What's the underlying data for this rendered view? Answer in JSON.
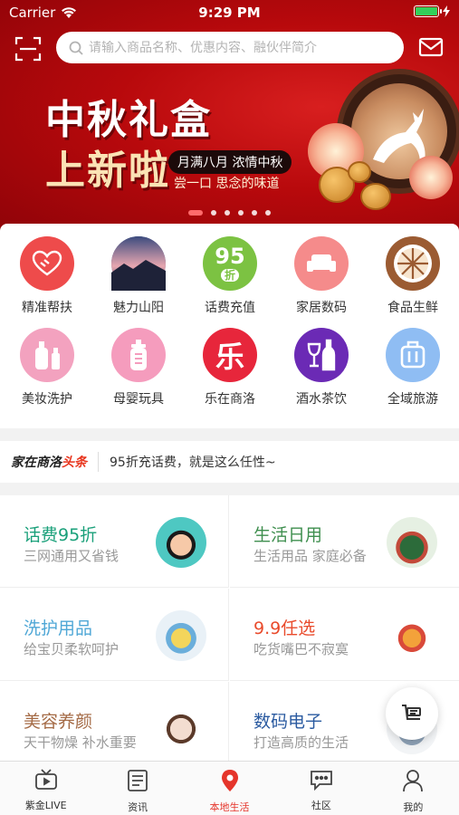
{
  "status_bar": {
    "carrier": "Carrier",
    "time": "9:29 PM",
    "battery_level": 1.0
  },
  "search": {
    "placeholder": "请输入商品名称、优惠内容、融伙伴简介",
    "scan_icon": "scan-icon",
    "mail_icon": "mail-icon"
  },
  "banner": {
    "title_line1": "中秋礼盒",
    "title_line2": "上新啦",
    "subtitle": "月满八月 浓情中秋",
    "subtitle2": "尝一口 思念的味道",
    "slide_count": 6,
    "active_slide": 1
  },
  "categories": [
    {
      "label": "精准帮扶",
      "icon": "handshake-icon",
      "color": "#ee4b4b"
    },
    {
      "label": "魅力山阳",
      "icon": "landscape-photo-icon",
      "color": "#4c5b8a"
    },
    {
      "label": "话费充值",
      "icon": "discount-95-icon",
      "color": "#7cc242",
      "badge_top": "95",
      "badge_bottom": "折"
    },
    {
      "label": "家居数码",
      "icon": "sofa-icon",
      "color": "#f58b8b"
    },
    {
      "label": "食品生鲜",
      "icon": "citrus-icon",
      "color": "#9b5b32"
    },
    {
      "label": "美妆洗护",
      "icon": "cosmetics-icon",
      "color": "#f3a2bf"
    },
    {
      "label": "母婴玩具",
      "icon": "baby-bottle-icon",
      "color": "#f59cbd"
    },
    {
      "label": "乐在商洛",
      "icon": "le-character-icon",
      "color": "#e7263b",
      "glyph": "乐"
    },
    {
      "label": "酒水茶饮",
      "icon": "wine-icon",
      "color": "#6b2ab5"
    },
    {
      "label": "全域旅游",
      "icon": "luggage-icon",
      "color": "#8fbdf3"
    }
  ],
  "news": {
    "logo_black": "家在商洛",
    "logo_red": "头条",
    "headline": "95折充话费，就是这么任性~"
  },
  "promos": [
    {
      "title": "话费95折",
      "subtitle": "三网通用又省钱",
      "color": "#1aa07a",
      "icon": "kid-phone-icon"
    },
    {
      "title": "生活日用",
      "subtitle": "生活用品 家庭必备",
      "color": "#3f8f4f",
      "icon": "grocery-bag-icon"
    },
    {
      "title": "洗护用品",
      "subtitle": "给宝贝柔软呵护",
      "color": "#4fa7d6",
      "icon": "bath-bottles-icon"
    },
    {
      "title": "9.9任选",
      "subtitle": "吃货嘴巴不寂寞",
      "color": "#e94b2c",
      "icon": "snacks-icon"
    },
    {
      "title": "美容养颜",
      "subtitle": "天干物燥 补水重要",
      "color": "#a46a45",
      "icon": "face-mask-icon"
    },
    {
      "title": "数码电子",
      "subtitle": "打造高质的生活",
      "color": "#2a5aa0",
      "icon": "electronics-icon"
    }
  ],
  "cart_fab": {
    "icon": "cart-icon"
  },
  "tabs": [
    {
      "label": "紫金LIVE",
      "icon": "tv-icon",
      "active": false
    },
    {
      "label": "资讯",
      "icon": "news-list-icon",
      "active": false
    },
    {
      "label": "本地生活",
      "icon": "location-pin-icon",
      "active": true
    },
    {
      "label": "社区",
      "icon": "chat-bubble-icon",
      "active": false
    },
    {
      "label": "我的",
      "icon": "person-icon",
      "active": false
    }
  ],
  "colors": {
    "brand_red": "#e5352b",
    "tab_active": "#e5352b"
  }
}
